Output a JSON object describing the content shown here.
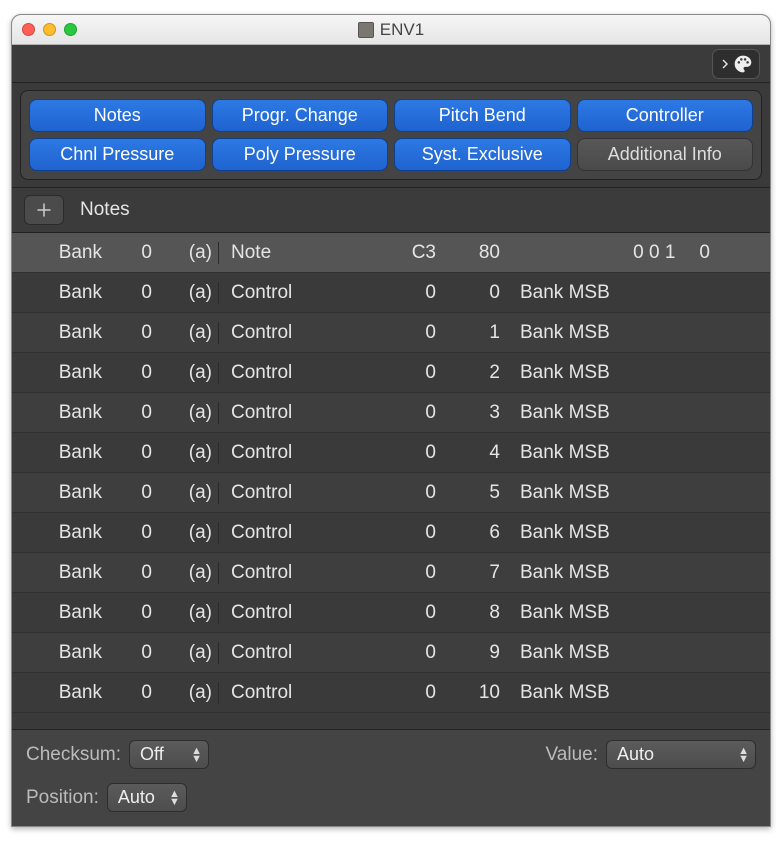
{
  "window": {
    "title": "ENV1"
  },
  "filters": {
    "row1": [
      {
        "label": "Notes",
        "active": true
      },
      {
        "label": "Progr. Change",
        "active": true
      },
      {
        "label": "Pitch Bend",
        "active": true
      },
      {
        "label": "Controller",
        "active": true
      }
    ],
    "row2": [
      {
        "label": "Chnl Pressure",
        "active": true
      },
      {
        "label": "Poly Pressure",
        "active": true
      },
      {
        "label": "Syst. Exclusive",
        "active": true
      },
      {
        "label": "Additional Info",
        "active": false
      }
    ]
  },
  "section": {
    "title": "Notes"
  },
  "header_row": {
    "bank": "Bank",
    "n": "0",
    "a": "(a)",
    "type": "Note",
    "v1": "C3",
    "v2": "80",
    "right": "0 0 1",
    "extra": "0"
  },
  "rows": [
    {
      "bank": "Bank",
      "n": "0",
      "a": "(a)",
      "type": "Control",
      "v1": "0",
      "v2": "0",
      "desc": "Bank MSB"
    },
    {
      "bank": "Bank",
      "n": "0",
      "a": "(a)",
      "type": "Control",
      "v1": "0",
      "v2": "1",
      "desc": "Bank MSB"
    },
    {
      "bank": "Bank",
      "n": "0",
      "a": "(a)",
      "type": "Control",
      "v1": "0",
      "v2": "2",
      "desc": "Bank MSB"
    },
    {
      "bank": "Bank",
      "n": "0",
      "a": "(a)",
      "type": "Control",
      "v1": "0",
      "v2": "3",
      "desc": "Bank MSB"
    },
    {
      "bank": "Bank",
      "n": "0",
      "a": "(a)",
      "type": "Control",
      "v1": "0",
      "v2": "4",
      "desc": "Bank MSB"
    },
    {
      "bank": "Bank",
      "n": "0",
      "a": "(a)",
      "type": "Control",
      "v1": "0",
      "v2": "5",
      "desc": "Bank MSB"
    },
    {
      "bank": "Bank",
      "n": "0",
      "a": "(a)",
      "type": "Control",
      "v1": "0",
      "v2": "6",
      "desc": "Bank MSB"
    },
    {
      "bank": "Bank",
      "n": "0",
      "a": "(a)",
      "type": "Control",
      "v1": "0",
      "v2": "7",
      "desc": "Bank MSB"
    },
    {
      "bank": "Bank",
      "n": "0",
      "a": "(a)",
      "type": "Control",
      "v1": "0",
      "v2": "8",
      "desc": "Bank MSB"
    },
    {
      "bank": "Bank",
      "n": "0",
      "a": "(a)",
      "type": "Control",
      "v1": "0",
      "v2": "9",
      "desc": "Bank MSB"
    },
    {
      "bank": "Bank",
      "n": "0",
      "a": "(a)",
      "type": "Control",
      "v1": "0",
      "v2": "10",
      "desc": "Bank MSB"
    }
  ],
  "footer": {
    "checksum_label": "Checksum:",
    "checksum_value": "Off",
    "value_label": "Value:",
    "value_value": "Auto",
    "position_label": "Position:",
    "position_value": "Auto"
  }
}
